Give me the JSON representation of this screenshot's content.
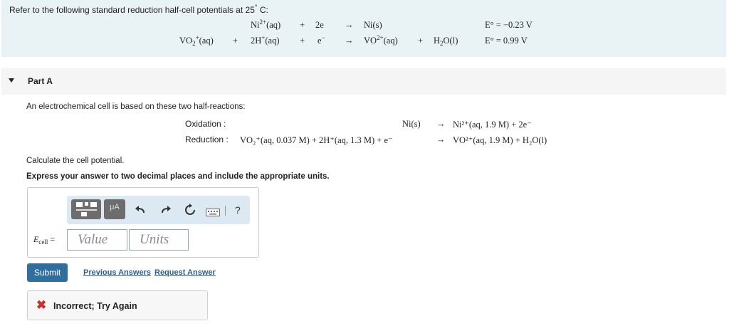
{
  "intro": {
    "text_prefix": "Refer to the following standard reduction half-cell potentials at 25",
    "degree": "°",
    "text_suffix": " C:"
  },
  "half_reactions": [
    {
      "lhs_a": "",
      "plus1": "",
      "lhs_b_main": "Ni",
      "lhs_b_sup": "2+",
      "lhs_b_tail": "(aq)",
      "plus2": "+",
      "electron": "2e",
      "arrow": "→",
      "product": "Ni(s)",
      "potential": "E° = −0.23 V"
    },
    {
      "lhs_a_main": "VO",
      "lhs_a_sub": "2",
      "lhs_a_sup": "+",
      "lhs_a_tail": "(aq)",
      "plus1": "+",
      "lhs_b_main": "2H",
      "lhs_b_sup": "+",
      "lhs_b_tail": "(aq)",
      "plus2": "+",
      "electron": "e",
      "electron_sup": "−",
      "arrow": "→",
      "product_main": "VO",
      "product_sup": "2+",
      "product_tail": "(aq)",
      "plus3": "+",
      "product2_main": "H",
      "product2_sub": "2",
      "product2_tail": "O(l)",
      "potential": "E° = 0.99 V"
    }
  ],
  "part": {
    "title": "Part A"
  },
  "question": {
    "intro": "An electrochemical cell is based on these two half-reactions:",
    "oxidation_label": "Oxidation :",
    "oxidation_lhs": "Ni(s)",
    "oxidation_arrow": "→",
    "oxidation_rhs": "Ni²⁺(aq, 1.9 M) + 2e⁻",
    "reduction_label": "Reduction :",
    "reduction_lhs": "VO₂⁺(aq, 0.037 M) + 2H⁺(aq, 1.3 M) + e⁻",
    "reduction_arrow": "→",
    "reduction_rhs": "VO²⁺(aq, 1.9 M) + H₂O(l)",
    "prompt": "Calculate the cell potential.",
    "instruction": "Express your answer to two decimal places and include the appropriate units."
  },
  "answer": {
    "label_main": "E",
    "label_sub": "cell",
    "label_eq": " =",
    "value_placeholder": "Value",
    "units_placeholder": "Units",
    "toolbar": {
      "mu_label": "μA",
      "help_label": "?"
    }
  },
  "actions": {
    "submit": "Submit",
    "previous_answers": "Previous Answers",
    "request_answer": "Request Answer"
  },
  "feedback": {
    "icon": "✖",
    "text": "Incorrect; Try Again"
  },
  "colors": {
    "panel_bg": "#e9f2f5",
    "submit_bg": "#2e6f9e",
    "link": "#2e5d94",
    "error": "#c8312b"
  }
}
